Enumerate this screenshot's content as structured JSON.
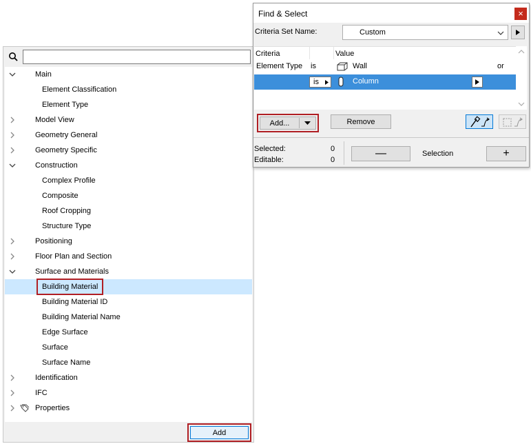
{
  "tree_panel": {
    "search": {
      "value": "",
      "placeholder": ""
    },
    "items": [
      {
        "label": "Main",
        "expanded": true,
        "level": 0
      },
      {
        "label": "Element Classification",
        "level": 1
      },
      {
        "label": "Element Type",
        "level": 1
      },
      {
        "label": "Model View",
        "expanded": false,
        "level": 0
      },
      {
        "label": "Geometry General",
        "expanded": false,
        "level": 0
      },
      {
        "label": "Geometry Specific",
        "expanded": false,
        "level": 0
      },
      {
        "label": "Construction",
        "expanded": true,
        "level": 0
      },
      {
        "label": "Complex Profile",
        "level": 1
      },
      {
        "label": "Composite",
        "level": 1
      },
      {
        "label": "Roof Cropping",
        "level": 1
      },
      {
        "label": "Structure Type",
        "level": 1
      },
      {
        "label": "Positioning",
        "expanded": false,
        "level": 0
      },
      {
        "label": "Floor Plan and Section",
        "expanded": false,
        "level": 0
      },
      {
        "label": "Surface and Materials",
        "expanded": true,
        "level": 0
      },
      {
        "label": "Building Material",
        "level": 1,
        "selected": true
      },
      {
        "label": "Building Material ID",
        "level": 1
      },
      {
        "label": "Building Material Name",
        "level": 1
      },
      {
        "label": "Edge Surface",
        "level": 1
      },
      {
        "label": "Surface",
        "level": 1
      },
      {
        "label": "Surface Name",
        "level": 1
      },
      {
        "label": "Identification",
        "expanded": false,
        "level": 0
      },
      {
        "label": "IFC",
        "expanded": false,
        "level": 0
      },
      {
        "label": "Properties",
        "expanded": false,
        "level": 0,
        "icon": "tag-icon"
      }
    ],
    "add_button_label": "Add"
  },
  "dialog": {
    "title": "Find & Select",
    "close_symbol": "×",
    "criteria_set_label": "Criteria Set Name:",
    "criteria_set_value": "Custom",
    "headers": {
      "criteria": "Criteria",
      "value": "Value"
    },
    "rows": [
      {
        "criteria": "Element Type",
        "operator": "is",
        "value": "Wall",
        "icon": "wall-icon",
        "suffix": "or"
      },
      {
        "criteria": "",
        "operator": "is",
        "value": "Column",
        "icon": "column-icon",
        "selected": true
      }
    ],
    "add_label": "Add...",
    "remove_label": "Remove",
    "selected_label": "Selected:",
    "selected_value": "0",
    "editable_label": "Editable:",
    "editable_value": "0",
    "minus_label": "—",
    "selection_label": "Selection",
    "plus_label": "+"
  },
  "colors": {
    "accent": "#0078d7",
    "highlight_outline": "#b01e23",
    "selected_row": "#3c8fdb",
    "tree_selected": "#cce8ff"
  }
}
